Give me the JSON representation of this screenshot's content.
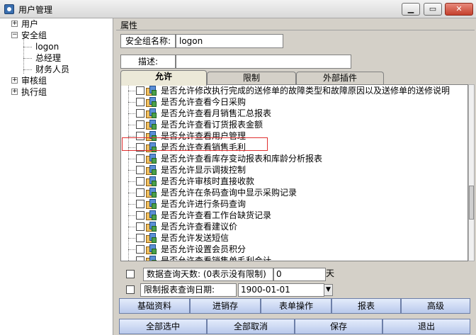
{
  "window": {
    "title": "用户管理",
    "minimize": "▁",
    "restore": "▭",
    "close": "✕"
  },
  "tree": {
    "nodes": [
      {
        "label": "用户",
        "expander": "+"
      },
      {
        "label": "安全组",
        "expander": "−"
      },
      {
        "label": "logon"
      },
      {
        "label": "总经理"
      },
      {
        "label": "财务人员"
      },
      {
        "label": "审核组",
        "expander": "+"
      },
      {
        "label": "执行组",
        "expander": "+"
      }
    ]
  },
  "properties": {
    "title": "属性",
    "group_name_label": "安全组名称:",
    "group_name_value": "logon",
    "description_label": "描述:",
    "description_value": ""
  },
  "tabs": [
    {
      "label": "允许"
    },
    {
      "label": "限制"
    },
    {
      "label": "外部插件"
    }
  ],
  "permissions": [
    "是否允许修改执行完成的送修单的故障类型和故障原因以及送修单的送修说明",
    "是否允许查看今日采购",
    "是否允许查看月销售汇总报表",
    "是否允许查看订货报表金额",
    "是否允许查看用户管理",
    "是否允许查看销售毛利",
    "是否允许查看库存变动报表和库龄分析报表",
    "是否允许显示调拨控制",
    "是否允许审核时直接收款",
    "是否允许在条码查询中显示采购记录",
    "是否允许进行条码查询",
    "是否允许查看工作台缺货记录",
    "是否允许查看建议价",
    "是否允许发送短信",
    "是否允许设置会员积分",
    "是否允许查看销售单毛利合计"
  ],
  "query_days": {
    "label": "数据查询天数: (0表示没有限制)",
    "value": "0",
    "unit": "天"
  },
  "report_date": {
    "label": "限制报表查询日期:",
    "value": "1900-01-01",
    "arrow": "▼"
  },
  "categories": [
    "基础资料",
    "进销存",
    "表单操作",
    "报表",
    "高级"
  ],
  "actions": [
    "全部选中",
    "全部取消",
    "保存",
    "退出"
  ]
}
